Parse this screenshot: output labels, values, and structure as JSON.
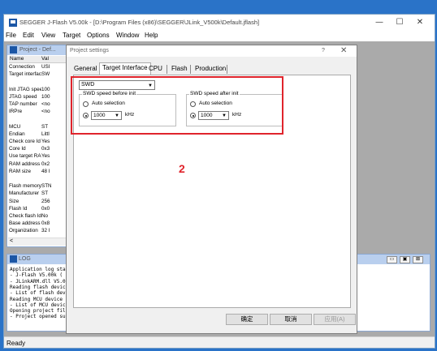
{
  "window": {
    "title": "SEGGER J-Flash V5.00k - [D:\\Program Files (x86)\\SEGGER\\JLink_V500k\\Default.jflash]",
    "minimize": "—",
    "maximize": "☐",
    "close": "✕"
  },
  "menu": [
    "File",
    "Edit",
    "View",
    "Target",
    "Options",
    "Window",
    "Help"
  ],
  "project_panel": {
    "title": "Project - Def...",
    "headers": [
      "Name",
      "Val"
    ],
    "rows": [
      {
        "name": "Connection",
        "value": "USI"
      },
      {
        "name": "Target interface",
        "value": "SW"
      },
      {
        "name": "",
        "value": ""
      },
      {
        "name": "Init JTAG speed",
        "value": "100"
      },
      {
        "name": "JTAG speed",
        "value": "100"
      },
      {
        "name": "TAP number",
        "value": "<no"
      },
      {
        "name": "IRPre",
        "value": "<no"
      },
      {
        "name": "",
        "value": ""
      },
      {
        "name": "MCU",
        "value": "ST"
      },
      {
        "name": "Endian",
        "value": "Littl"
      },
      {
        "name": "Check core Id",
        "value": "Yes"
      },
      {
        "name": "Core Id",
        "value": "0x3"
      },
      {
        "name": "Use target RAM",
        "value": "Yes"
      },
      {
        "name": "RAM address",
        "value": "0x2"
      },
      {
        "name": "RAM size",
        "value": "48 I"
      },
      {
        "name": "",
        "value": ""
      },
      {
        "name": "Flash memory",
        "value": "STN"
      },
      {
        "name": "Manufacturer",
        "value": "ST"
      },
      {
        "name": "Size",
        "value": "256"
      },
      {
        "name": "Flash Id",
        "value": "0x0"
      },
      {
        "name": "Check flash Id",
        "value": "No"
      },
      {
        "name": "Base address",
        "value": "0x8"
      },
      {
        "name": "Organization",
        "value": "32 I"
      }
    ],
    "scroll_left": "<"
  },
  "log_panel": {
    "title": "LOG",
    "lines": [
      "Application log star",
      " - J-Flash V5.00k (",
      " - JLinkARM.dll V5.0",
      "Reading flash device",
      " - List of flash dev",
      "Reading MCU device l",
      " - List of MCU devic",
      "Opening project file",
      " - Project opened su"
    ],
    "buttons": [
      "▭",
      "▣",
      "⊠"
    ]
  },
  "dialog": {
    "title": "Project settings",
    "help": "?",
    "close": "✕",
    "tabs": [
      "General",
      "Target Interface",
      "CPU",
      "Flash",
      "Production"
    ],
    "active_tab": "Target Interface",
    "interface_value": "SWD",
    "before_init": {
      "label": "SWD speed before init",
      "auto_label": "Auto selection",
      "speed_value": "1000",
      "unit": "kHz"
    },
    "after_init": {
      "label": "SWD speed after init",
      "auto_label": "Auto selection",
      "speed_value": "1000",
      "unit": "kHz"
    },
    "buttons": {
      "ok": "确定",
      "cancel": "取消",
      "apply": "应用(A)"
    }
  },
  "annotation": "2",
  "status": "Ready",
  "colors": {
    "highlight": "#e0242c",
    "title_active": "#b9cfee",
    "desktop": "#2a73c8"
  }
}
